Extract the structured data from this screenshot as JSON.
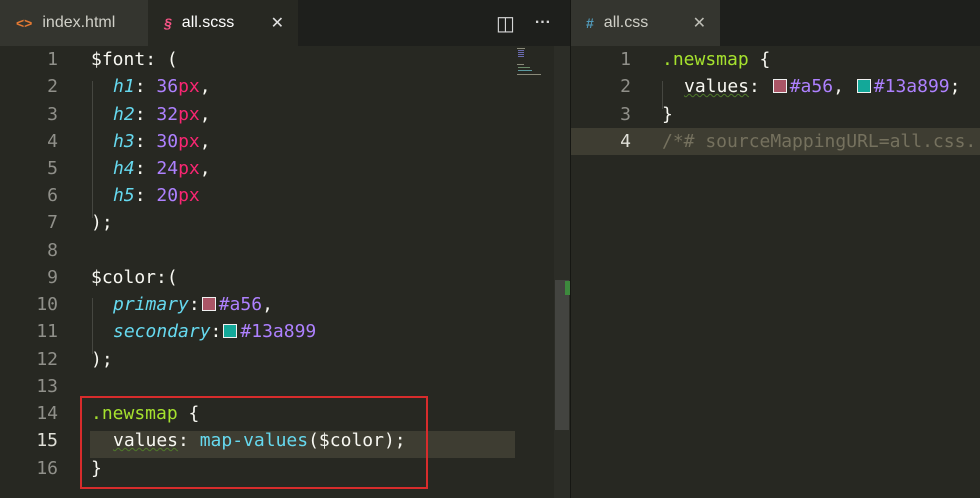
{
  "tabs_left": [
    {
      "label": "index.html",
      "icon": "html-file-icon",
      "icon_glyph": "<>",
      "icon_color": "#e37933",
      "active": false
    },
    {
      "label": "all.scss",
      "icon": "sass-file-icon",
      "icon_glyph": "§",
      "icon_color": "#f55385",
      "active": true
    }
  ],
  "tabs_right": [
    {
      "label": "all.css",
      "icon": "css-file-icon",
      "icon_glyph": "#",
      "icon_color": "#519aba",
      "active": true
    }
  ],
  "close_glyph": "✕",
  "actions": {
    "split_glyph": "◫",
    "more_glyph": "···"
  },
  "left_editor": {
    "line_numbers": [
      "1",
      "2",
      "3",
      "4",
      "5",
      "6",
      "7",
      "8",
      "9",
      "10",
      "11",
      "12",
      "13",
      "14",
      "15",
      "16"
    ],
    "current_line": "15",
    "lines": {
      "l1": {
        "var": "$font",
        "rest": ": ("
      },
      "l2": {
        "key": "h1",
        "colon": ": ",
        "num": "36",
        "unit": "px",
        "end": ","
      },
      "l3": {
        "key": "h2",
        "colon": ": ",
        "num": "32",
        "unit": "px",
        "end": ","
      },
      "l4": {
        "key": "h3",
        "colon": ": ",
        "num": "30",
        "unit": "px",
        "end": ","
      },
      "l5": {
        "key": "h4",
        "colon": ": ",
        "num": "24",
        "unit": "px",
        "end": ","
      },
      "l6": {
        "key": "h5",
        "colon": ": ",
        "num": "20",
        "unit": "px",
        "end": ""
      },
      "l7": {
        "text": ");"
      },
      "l9": {
        "var": "$color",
        "rest": ":("
      },
      "l10": {
        "key": "primary",
        "colon": ":",
        "color": "#a56",
        "end": ","
      },
      "l11": {
        "key": "secondary",
        "colon": ":",
        "color": "#13a899",
        "end": ""
      },
      "l12": {
        "text": ");"
      },
      "l14": {
        "sel": ".newsmap",
        "rest": " {"
      },
      "l15": {
        "prop": "values",
        "colon": ": ",
        "fn": "map-values",
        "args": "($color);"
      },
      "l16": {
        "text": "}"
      }
    }
  },
  "right_editor": {
    "line_numbers": [
      "1",
      "2",
      "3",
      "4"
    ],
    "current_line": "4",
    "l1": {
      "sel": ".newsmap",
      "rest": " {"
    },
    "l2": {
      "prop": "values",
      "colon": ": ",
      "c1": "#a56",
      "sep": ", ",
      "c2": "#13a899",
      "end": ";"
    },
    "l3": {
      "text": "}"
    },
    "l4": {
      "comment": "/*# sourceMappingURL=all.css."
    }
  },
  "colors": {
    "swatch_a56": "#aa5566",
    "swatch_13a899": "#13a899",
    "highlight_box": "#d82c2c"
  }
}
